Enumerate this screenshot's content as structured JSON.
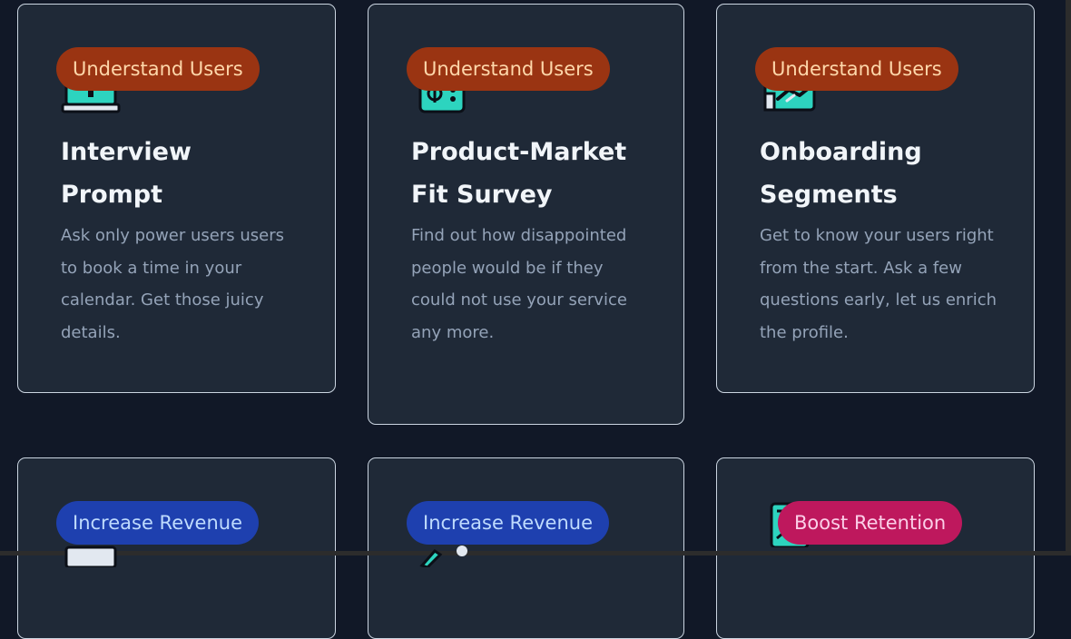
{
  "cards": [
    {
      "badge": "Understand Users",
      "icon": "computer-upload-icon",
      "title": "Interview Prompt",
      "description": "Ask only power users users to book a time in your calendar. Get those juicy details."
    },
    {
      "badge": "Understand Users",
      "icon": "phone-document-icon",
      "title": "Product-Market Fit Survey",
      "description": "Find out how disappointed people would be if they could not use your service any more."
    },
    {
      "badge": "Understand Users",
      "icon": "handshake-icon",
      "title": "Onboarding Segments",
      "description": "Get to know your users right from the start. Ask a few questions early, let us enrich the profile."
    },
    {
      "badge": "Increase Revenue",
      "icon": "computer-icon"
    },
    {
      "badge": "Increase Revenue",
      "icon": "pencil-icon"
    },
    {
      "badge": "Boost Retention",
      "icon": "chat-icon"
    }
  ],
  "colors": {
    "understand_users": "#9a3412",
    "increase_revenue": "#1e40af",
    "boost_retention": "#be185d",
    "icon_accent": "#2dd4bf"
  }
}
